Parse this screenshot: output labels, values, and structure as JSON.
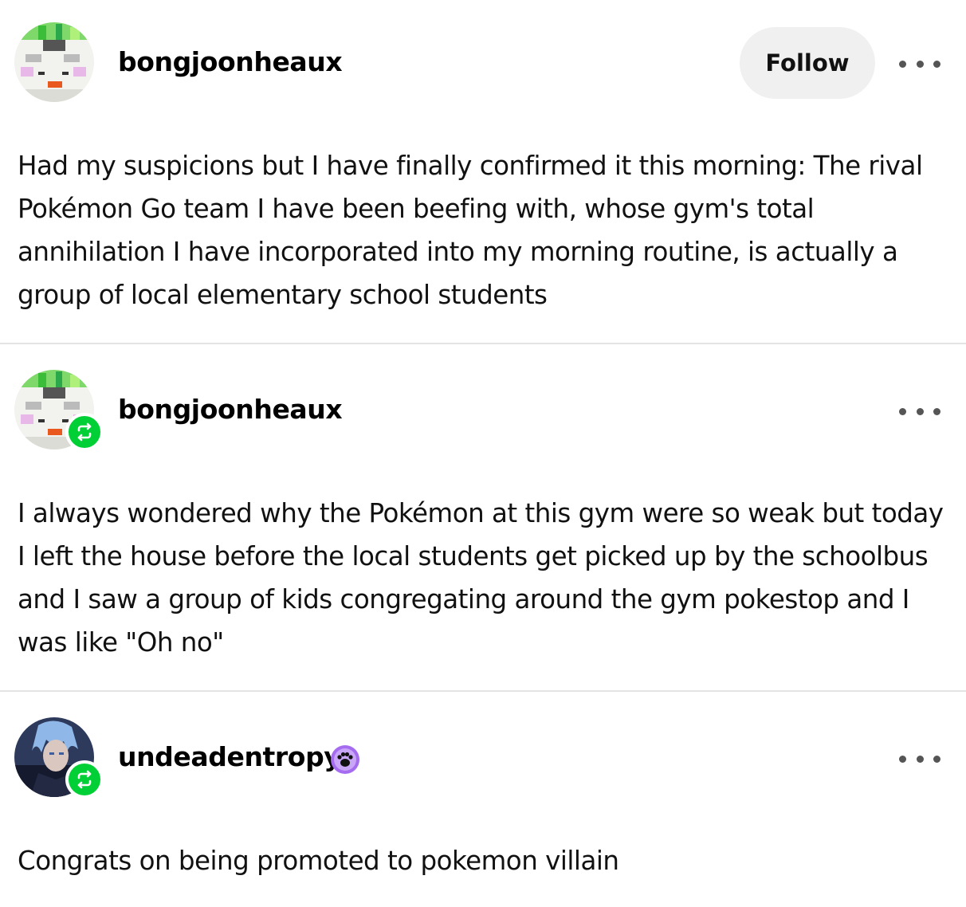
{
  "posts": [
    {
      "username": "bongjoonheaux",
      "follow_label": "Follow",
      "body": "Had my suspicions but I have finally confirmed it this morning: The rival Pokémon Go team I have been beefing with, whose gym's total annihilation I have incorporated into my morning routine, is actually a group of local elementary school students"
    },
    {
      "username": "bongjoonheaux",
      "body": "I always wondered why the Pokémon at this gym were so weak but today I left the house before the local students get picked up by the schoolbus and I saw a group of kids congregating around the gym pokestop and I was like \"Oh no\""
    },
    {
      "username": "undeadentropy",
      "body": "Congrats on being promoted to pokemon villain"
    }
  ],
  "icons": {
    "reblog": "reblog-icon",
    "more": "more-options-icon",
    "user_badge": "paw-badge-icon"
  },
  "colors": {
    "reblog_green": "#00cf35",
    "follow_bg": "#f0f0f0",
    "divider": "#e4e4e4",
    "badge_purple": "#a56cf0"
  }
}
